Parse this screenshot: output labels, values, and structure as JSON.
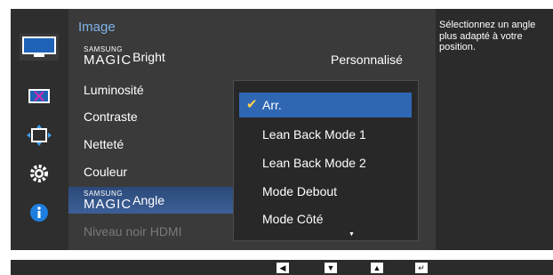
{
  "sidebar": {
    "icons": [
      "picture-icon",
      "color-icon",
      "size-position-icon",
      "settings-icon",
      "info-icon"
    ]
  },
  "menu": {
    "title": "Image",
    "magic_prefix_top": "SAMSUNG",
    "magic_prefix_bottom": "MAGIC",
    "items": [
      {
        "label": "Bright"
      },
      {
        "label": "Luminosité"
      },
      {
        "label": "Contraste"
      },
      {
        "label": "Netteté"
      },
      {
        "label": "Couleur"
      },
      {
        "label": "Angle"
      },
      {
        "label": "Niveau noir HDMI"
      }
    ],
    "bright_value": "Personnalisé"
  },
  "dropdown": {
    "options": [
      "Arr.",
      "Lean Back Mode 1",
      "Lean Back Mode 2",
      "Mode Debout",
      "Mode Côté"
    ],
    "selected": "Arr."
  },
  "help": {
    "text": "Sélectionnez un angle plus adapté à votre position."
  },
  "bottom_bar": {
    "keys": [
      "left-arrow",
      "down-arrow",
      "up-arrow",
      "enter"
    ]
  },
  "colors": {
    "title": "#7fb4e8",
    "selected": "#2f67b3",
    "check": "#ffd24a"
  }
}
